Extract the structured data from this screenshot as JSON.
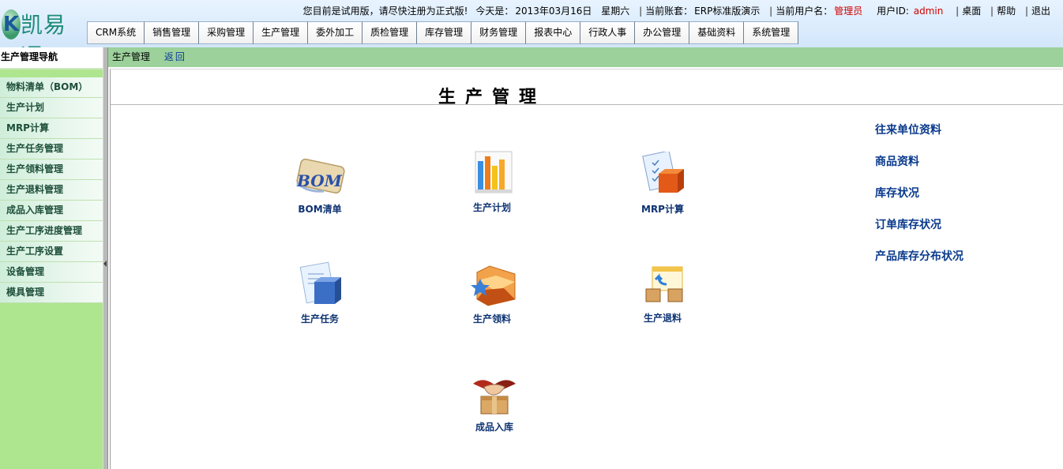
{
  "app": {
    "logo_letter": "K",
    "logo_text": "凯易通"
  },
  "topbar": {
    "notice": "您目前是试用版，请尽快注册为正式版!",
    "today_label": "今天是：",
    "date": "2013年03月16日",
    "weekday": "星期六",
    "account_label": "当前账套：",
    "account": "ERP标准版演示",
    "user_label": "当前用户名：",
    "user": "管理员",
    "userid_label": "用户ID:",
    "userid": "admin",
    "desktop": "桌面",
    "help": "帮助",
    "logout": "退出",
    "sep": "|"
  },
  "nav": {
    "items": [
      "CRM系统",
      "销售管理",
      "采购管理",
      "生产管理",
      "委外加工",
      "质检管理",
      "库存管理",
      "财务管理",
      "报表中心",
      "行政人事",
      "办公管理",
      "基础资料",
      "系统管理"
    ]
  },
  "sidebar": {
    "title": "生产管理导航",
    "items": [
      "物料清单（BOM）",
      "生产计划",
      "MRP计算",
      "生产任务管理",
      "生产领料管理",
      "生产退料管理",
      "成品入库管理",
      "生产工序进度管理",
      "生产工序设置",
      "设备管理",
      "模具管理"
    ]
  },
  "breadcrumb": {
    "current": "生产管理",
    "back": "返回"
  },
  "page": {
    "title": "生产管理"
  },
  "tiles": {
    "bom": "BOM清单",
    "plan": "生产计划",
    "mrp": "MRP计算",
    "task": "生产任务",
    "pick": "生产领料",
    "return": "生产退料",
    "stockin": "成品入库"
  },
  "quick_links": [
    "往来单位资料",
    "商品资料",
    "库存状况",
    "订单库存状况",
    "产品库存分布状况"
  ],
  "colors": {
    "sidebar_bg": "#aee58f",
    "crumb_bg": "#9cd19b",
    "link": "#0a3a8c",
    "user_red": "#d00000"
  }
}
